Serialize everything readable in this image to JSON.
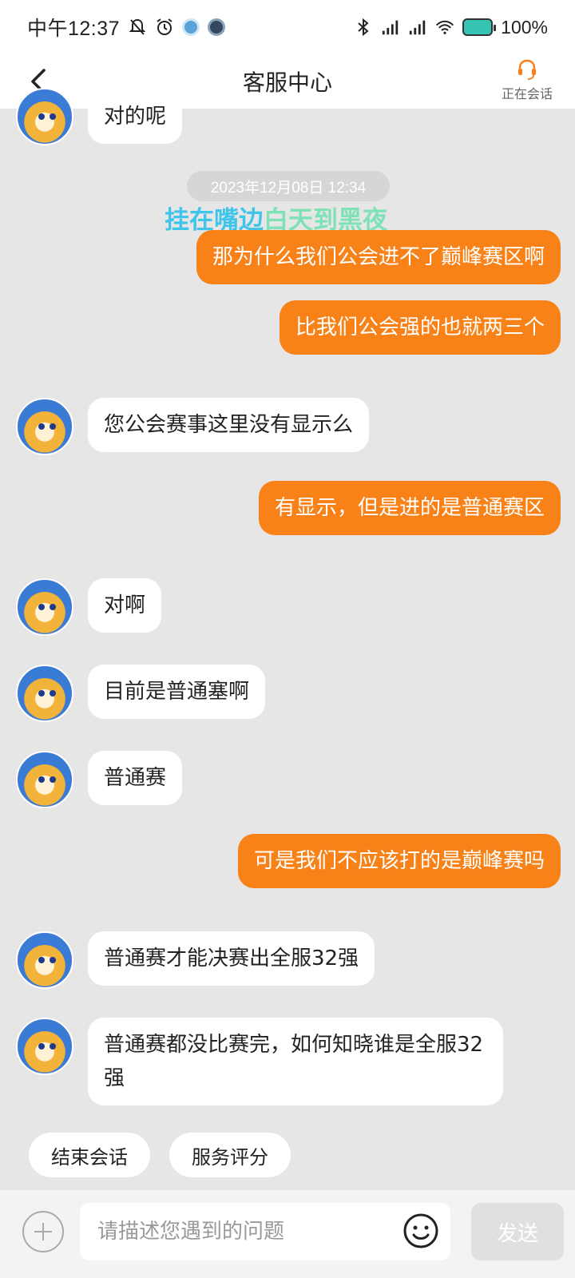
{
  "status_bar": {
    "time": "中午12:37",
    "battery": "100%"
  },
  "header": {
    "title": "客服中心",
    "status": "正在会话"
  },
  "chat": {
    "timestamp": "2023年12月08日 12:34",
    "watermark_part1": "挂在嘴边",
    "watermark_part2": "白天到黑夜",
    "messages": [
      {
        "side": "left",
        "text": "对的呢"
      },
      {
        "side": "right",
        "text": "那为什么我们公会进不了巅峰赛区啊"
      },
      {
        "side": "right",
        "text": "比我们公会强的也就两三个"
      },
      {
        "side": "left",
        "text": "您公会赛事这里没有显示么"
      },
      {
        "side": "right",
        "text": "有显示，但是进的是普通赛区"
      },
      {
        "side": "left",
        "text": "对啊"
      },
      {
        "side": "left",
        "text": "目前是普通塞啊"
      },
      {
        "side": "left",
        "text": "普通赛"
      },
      {
        "side": "right",
        "text": "可是我们不应该打的是巅峰赛吗"
      },
      {
        "side": "left",
        "text": "普通赛才能决赛出全服32强"
      },
      {
        "side": "left",
        "text": "普通赛都没比赛完，如何知晓谁是全服32强"
      }
    ]
  },
  "quick_actions": {
    "end_session": "结束会话",
    "rate_service": "服务评分"
  },
  "input": {
    "placeholder": "请描述您遇到的问题",
    "send_label": "发送"
  },
  "colors": {
    "accent": "#f98218",
    "background": "#e6e6e6"
  }
}
